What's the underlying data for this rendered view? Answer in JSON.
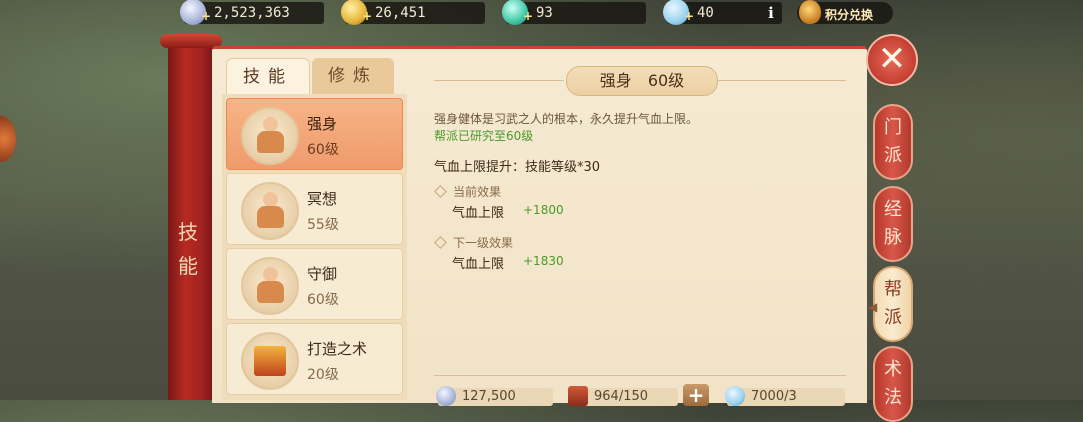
{
  "currencies": [
    {
      "name": "silver",
      "value": "2,523,363",
      "plus": "+"
    },
    {
      "name": "gold",
      "value": "26,451",
      "plus": "+"
    },
    {
      "name": "jade",
      "value": "93",
      "plus": "+"
    },
    {
      "name": "energy",
      "value": "40",
      "plus": "+"
    }
  ],
  "info_label": "i",
  "exchange_label": "积分兑换",
  "scroll_label": [
    "技",
    "能"
  ],
  "tabs": {
    "skill": "技能",
    "cultivate": "修炼"
  },
  "skills": [
    {
      "name": "强身",
      "level": "60级"
    },
    {
      "name": "冥想",
      "level": "55级"
    },
    {
      "name": "守御",
      "level": "60级"
    },
    {
      "name": "打造之术",
      "level": "20级"
    }
  ],
  "detail": {
    "title": "强身",
    "level": "60级",
    "description": "强身健体是习武之人的根本，永久提升气血上限。",
    "guild_note": "帮派已研究至60级",
    "effect_formula": "气血上限提升：技能等级*30",
    "current_label": "当前效果",
    "current_stat": "气血上限",
    "current_value": "+1800",
    "next_label": "下一级效果",
    "next_stat": "气血上限",
    "next_value": "+1830"
  },
  "costs": {
    "silver": "127,500",
    "contribution": "964/150",
    "plus": "+",
    "exp": "7000/3"
  },
  "close_label": "✕",
  "side_tabs": [
    {
      "label": "门派",
      "active": false
    },
    {
      "label": "经脉",
      "active": false
    },
    {
      "label": "帮派",
      "active": true
    },
    {
      "label": "术法",
      "active": false
    }
  ]
}
